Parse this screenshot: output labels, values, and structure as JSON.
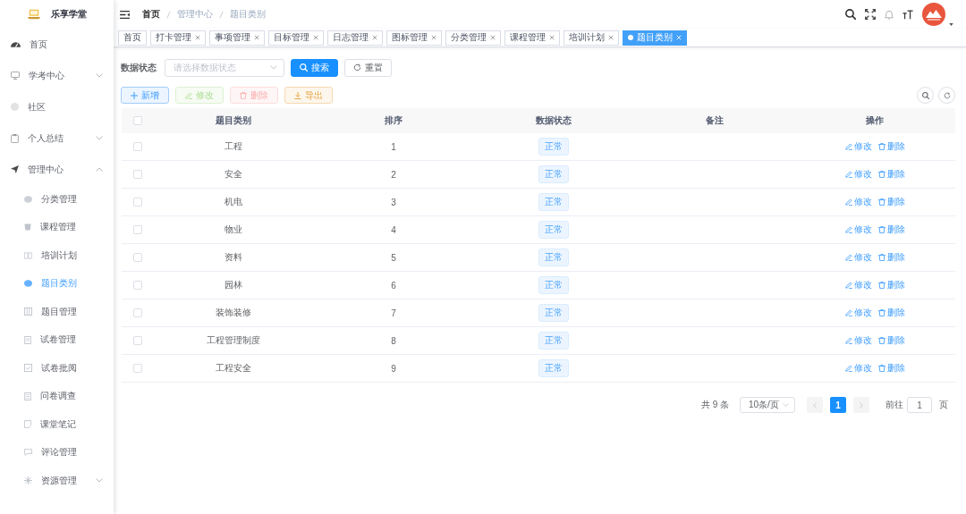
{
  "sidebar": {
    "logo": {
      "title": "乐享学堂"
    },
    "items": [
      {
        "label": "首页",
        "kind": "link",
        "selected": false
      },
      {
        "label": "学考中心",
        "kind": "group",
        "selected": false,
        "expanded": false
      },
      {
        "label": "社区",
        "kind": "link",
        "selected": false
      },
      {
        "label": "个人总结",
        "kind": "group",
        "selected": false,
        "expanded": false
      },
      {
        "label": "管理中心",
        "kind": "group",
        "selected": false,
        "expanded": true,
        "children": [
          {
            "label": "分类管理",
            "kind": "link",
            "selected": false
          },
          {
            "label": "课程管理",
            "kind": "link",
            "selected": false
          },
          {
            "label": "培训计划",
            "kind": "link",
            "selected": false
          },
          {
            "label": "题目类别",
            "kind": "link",
            "selected": true
          },
          {
            "label": "题目管理",
            "kind": "link",
            "selected": false
          },
          {
            "label": "试卷管理",
            "kind": "link",
            "selected": false
          },
          {
            "label": "试卷批阅",
            "kind": "link",
            "selected": false
          },
          {
            "label": "问卷调查",
            "kind": "link",
            "selected": false
          },
          {
            "label": "课堂笔记",
            "kind": "link",
            "selected": false
          },
          {
            "label": "评论管理",
            "kind": "link",
            "selected": false
          },
          {
            "label": "资源管理",
            "kind": "group",
            "selected": false,
            "expanded": false
          }
        ]
      }
    ]
  },
  "header": {
    "breadcrumb": [
      {
        "label": "首页",
        "kind": "link"
      },
      {
        "label": "管理中心",
        "kind": "text"
      },
      {
        "label": "题目类别",
        "kind": "text"
      }
    ]
  },
  "tags": [
    {
      "label": "首页",
      "closable": false,
      "selected": false
    },
    {
      "label": "打卡管理",
      "closable": true,
      "selected": false
    },
    {
      "label": "事项管理",
      "closable": true,
      "selected": false
    },
    {
      "label": "目标管理",
      "closable": true,
      "selected": false
    },
    {
      "label": "日志管理",
      "closable": true,
      "selected": false
    },
    {
      "label": "图标管理",
      "closable": true,
      "selected": false
    },
    {
      "label": "分类管理",
      "closable": true,
      "selected": false
    },
    {
      "label": "课程管理",
      "closable": true,
      "selected": false
    },
    {
      "label": "培训计划",
      "closable": true,
      "selected": false
    },
    {
      "label": "题目类别",
      "closable": true,
      "selected": true
    }
  ],
  "search_form": {
    "label": "数据状态",
    "placeholder": "请选择数据状态",
    "buttons": [
      {
        "label": "搜索",
        "kind": "primary"
      },
      {
        "label": "重置",
        "kind": "default"
      }
    ]
  },
  "toolbar": {
    "buttons": [
      {
        "label": "新增",
        "kind": "primary",
        "disabled": false
      },
      {
        "label": "修改",
        "kind": "success",
        "disabled": true
      },
      {
        "label": "删除",
        "kind": "danger",
        "disabled": true
      },
      {
        "label": "导出",
        "kind": "warning",
        "disabled": false
      }
    ]
  },
  "table": {
    "header_checked": false,
    "columns": [
      "题目类别",
      "排序",
      "数据状态",
      "备注",
      "操作"
    ],
    "rows": [
      {
        "checked": false,
        "category": "工程",
        "order": "1",
        "status": "正常",
        "actions": [
          {
            "label": "修改",
            "kind": "edit"
          },
          {
            "label": "删除",
            "kind": "delete"
          }
        ]
      },
      {
        "checked": false,
        "category": "安全",
        "order": "2",
        "status": "正常",
        "actions": [
          {
            "label": "修改",
            "kind": "edit"
          },
          {
            "label": "删除",
            "kind": "delete"
          }
        ]
      },
      {
        "checked": false,
        "category": "机电",
        "order": "3",
        "status": "正常",
        "actions": [
          {
            "label": "修改",
            "kind": "edit"
          },
          {
            "label": "删除",
            "kind": "delete"
          }
        ]
      },
      {
        "checked": false,
        "category": "物业",
        "order": "4",
        "status": "正常",
        "actions": [
          {
            "label": "修改",
            "kind": "edit"
          },
          {
            "label": "删除",
            "kind": "delete"
          }
        ]
      },
      {
        "checked": false,
        "category": "资料",
        "order": "5",
        "status": "正常",
        "actions": [
          {
            "label": "修改",
            "kind": "edit"
          },
          {
            "label": "删除",
            "kind": "delete"
          }
        ]
      },
      {
        "checked": false,
        "category": "园林",
        "order": "6",
        "status": "正常",
        "actions": [
          {
            "label": "修改",
            "kind": "edit"
          },
          {
            "label": "删除",
            "kind": "delete"
          }
        ]
      },
      {
        "checked": false,
        "category": "装饰装修",
        "order": "7",
        "status": "正常",
        "actions": [
          {
            "label": "修改",
            "kind": "edit"
          },
          {
            "label": "删除",
            "kind": "delete"
          }
        ]
      },
      {
        "checked": false,
        "category": "工程管理制度",
        "order": "8",
        "status": "正常",
        "actions": [
          {
            "label": "修改",
            "kind": "edit"
          },
          {
            "label": "删除",
            "kind": "delete"
          }
        ]
      },
      {
        "checked": false,
        "category": "工程安全",
        "order": "9",
        "status": "正常",
        "actions": [
          {
            "label": "修改",
            "kind": "edit"
          },
          {
            "label": "删除",
            "kind": "delete"
          }
        ]
      }
    ]
  },
  "pagination": {
    "total": "共 9 条",
    "page_size": "10条/页",
    "prev_disabled": true,
    "pages": [
      {
        "label": "1",
        "selected": true
      }
    ],
    "next_disabled": true,
    "jump_label": "前往",
    "jump_value": "1",
    "jump_suffix": "页"
  }
}
